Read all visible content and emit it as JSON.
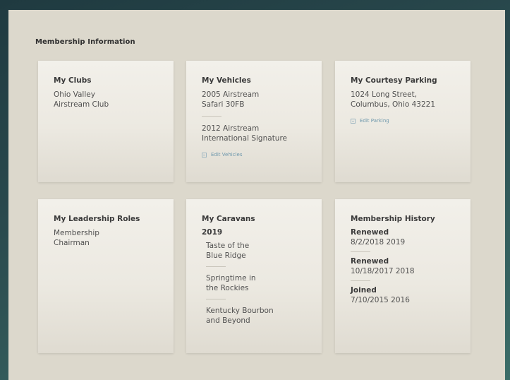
{
  "section_title": "Membership Information",
  "cards": {
    "clubs": {
      "title": "My Clubs",
      "lines": [
        "Ohio Valley",
        "Airstream Club"
      ]
    },
    "vehicles": {
      "title": "My Vehicles",
      "items": [
        {
          "line1": "2005 Airstream",
          "line2": "Safari 30FB"
        },
        {
          "line1": "2012 Airstream",
          "line2": "International Signature"
        }
      ],
      "edit_label": "Edit Vehicles"
    },
    "parking": {
      "title": "My Courtesy Parking",
      "lines": [
        "1024 Long Street,",
        "Columbus, Ohio 43221"
      ],
      "edit_label": "Edit Parking"
    },
    "leadership": {
      "title": "My Leadership Roles",
      "lines": [
        "Membership",
        "Chairman"
      ]
    },
    "caravans": {
      "title": "My Caravans",
      "year": "2019",
      "items": [
        {
          "line1": "Taste of the",
          "line2": "Blue Ridge"
        },
        {
          "line1": "Springtime in",
          "line2": "the Rockies"
        },
        {
          "line1": "Kentucky Bourbon",
          "line2": "and Beyond"
        }
      ]
    },
    "history": {
      "title": "Membership History",
      "entries": [
        {
          "status": "Renewed",
          "date": "8/2/2018 2019"
        },
        {
          "status": "Renewed",
          "date": "10/18/2017 2018"
        },
        {
          "status": "Joined",
          "date": "7/10/2015 2016"
        }
      ]
    }
  },
  "colors": {
    "frame": "#2a4a4e",
    "panel": "#dcd8cc",
    "card": "#eeebe4",
    "link": "#6e98ac"
  }
}
